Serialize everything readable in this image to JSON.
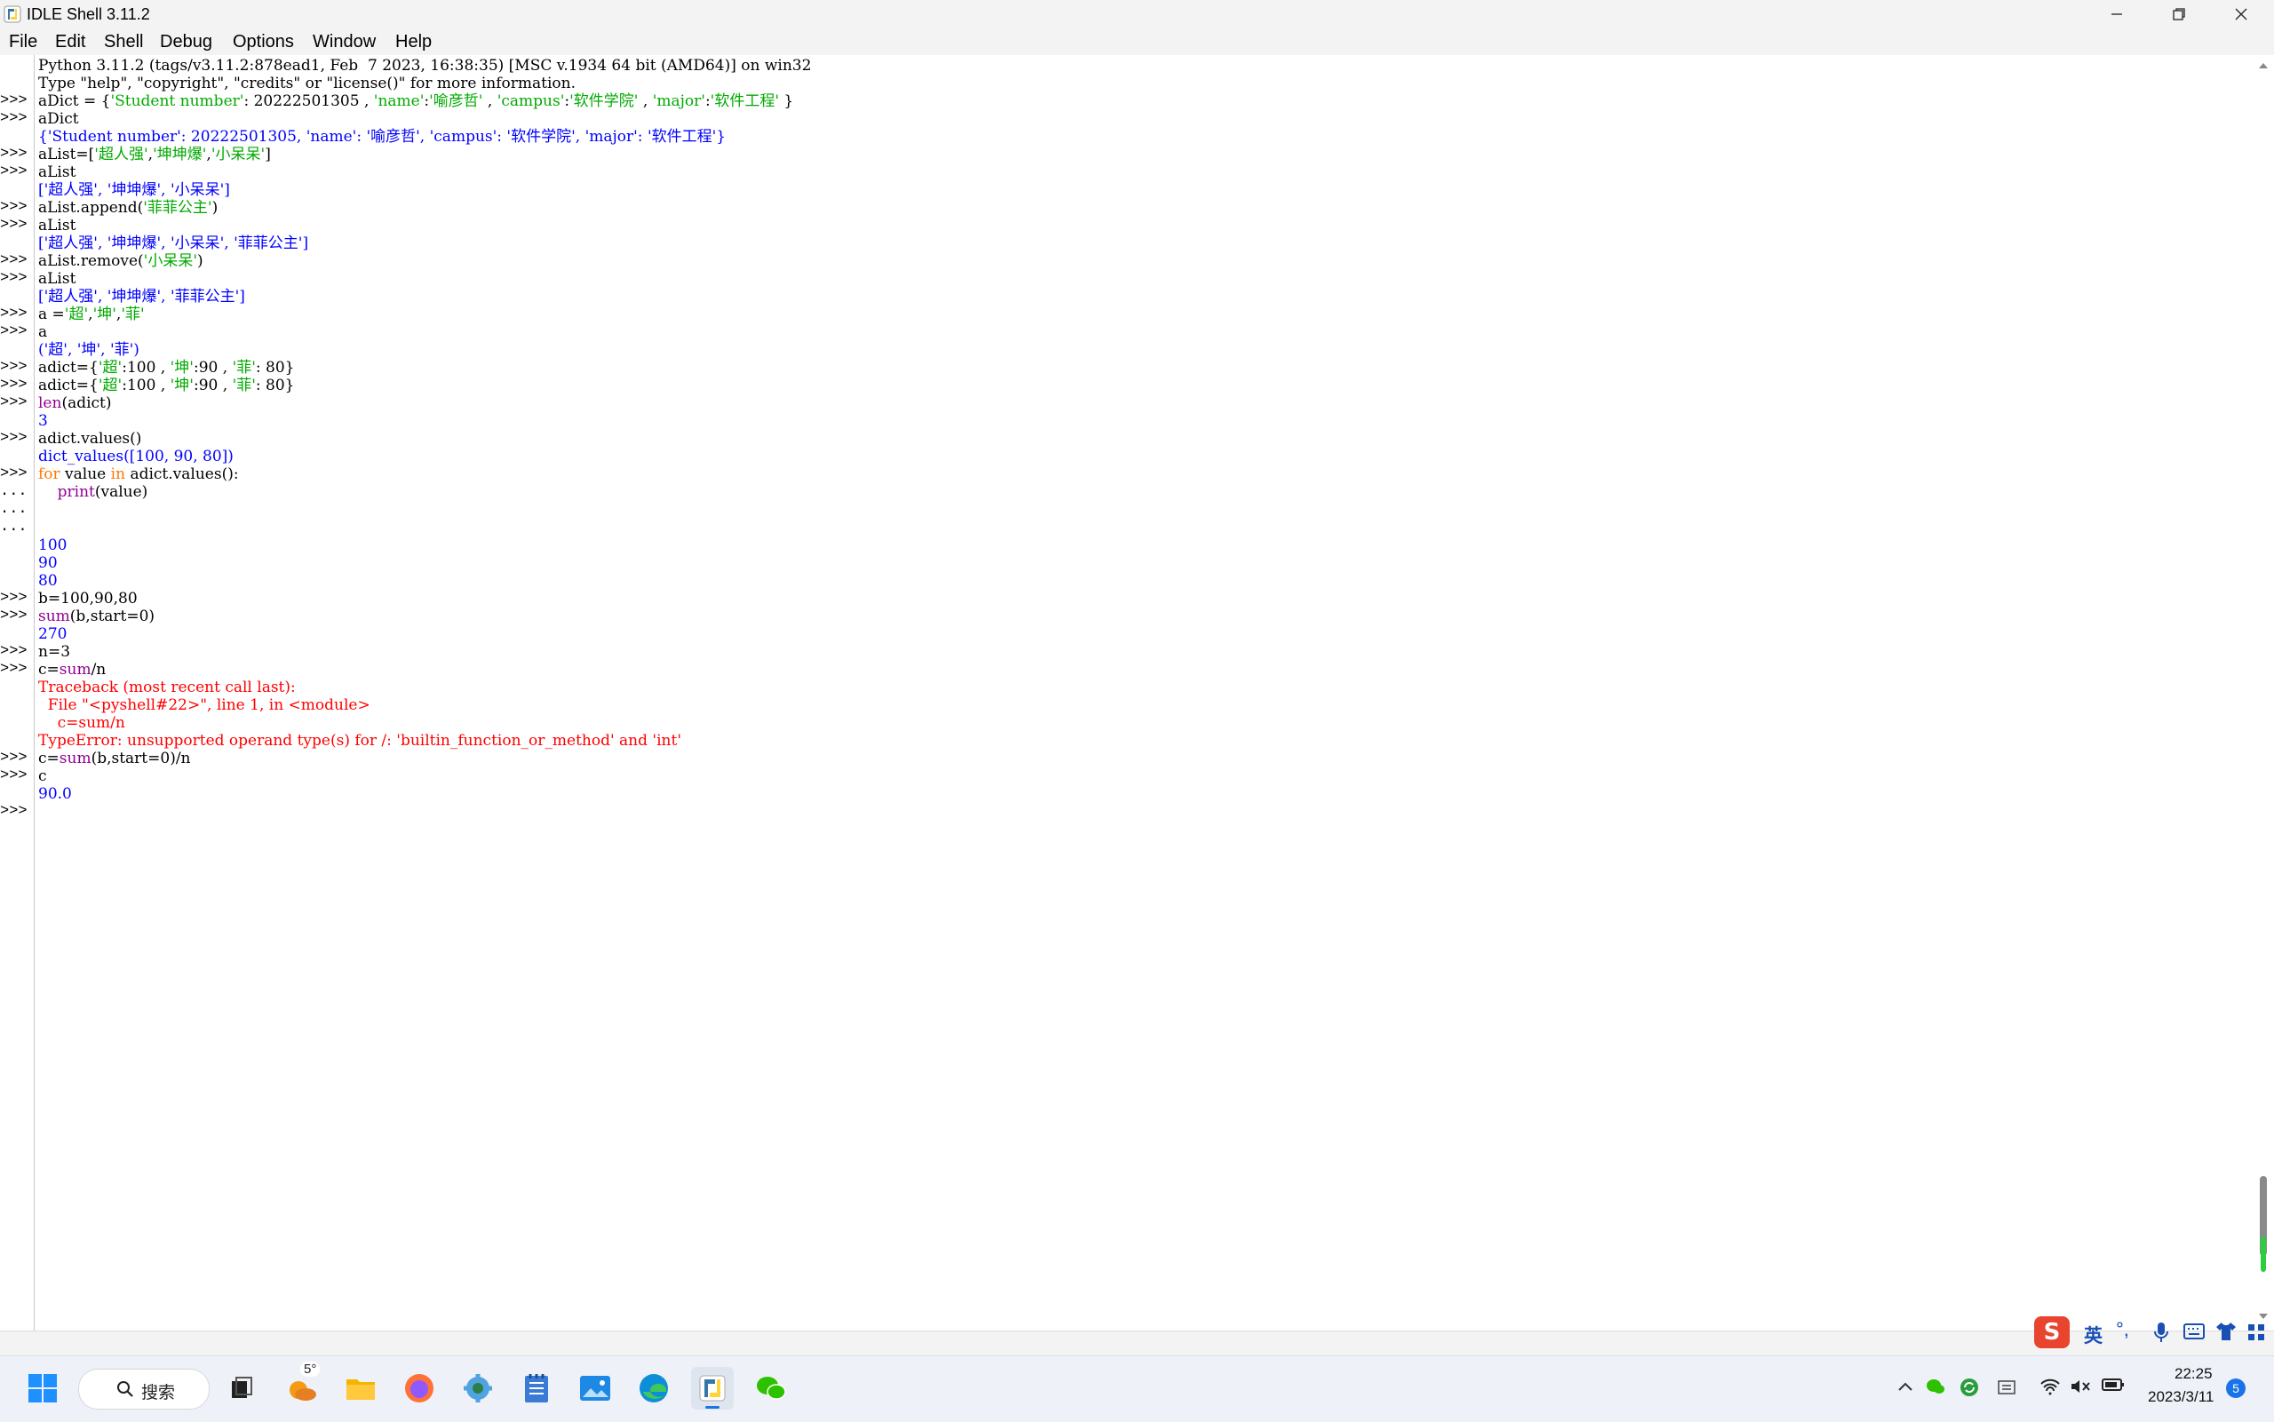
{
  "window": {
    "title": "IDLE Shell 3.11.2"
  },
  "menu": [
    "File",
    "Edit",
    "Shell",
    "Debug",
    "Options",
    "Window",
    "Help"
  ],
  "gutter": [
    "",
    "",
    ">>>",
    ">>>",
    "",
    ">>>",
    ">>>",
    "",
    ">>>",
    ">>>",
    "",
    ">>>",
    ">>>",
    "",
    ">>>",
    ">>>",
    "",
    ">>>",
    ">>>",
    ">>>",
    "",
    ">>>",
    "",
    ">>>",
    "...",
    "...",
    "...",
    "",
    "",
    "",
    ">>>",
    ">>>",
    "",
    ">>>",
    ">>>",
    "",
    "",
    "",
    "",
    ">>>",
    ">>>",
    "",
    ">>>"
  ],
  "lines": [
    [
      {
        "t": "Python 3.11.2 (tags/v3.11.2:878ead1, Feb  7 2023, 16:38:35) [MSC v.1934 64 bit (AMD64)] on win32",
        "c": ""
      }
    ],
    [
      {
        "t": "Type \"help\", \"copyright\", \"credits\" or \"license()\" for more information.",
        "c": ""
      }
    ],
    [
      {
        "t": "aDict = {",
        "c": ""
      },
      {
        "t": "'Student number'",
        "c": "s"
      },
      {
        "t": ": 20222501305 , ",
        "c": ""
      },
      {
        "t": "'name'",
        "c": "s"
      },
      {
        "t": ":",
        "c": ""
      },
      {
        "t": "'喻彦哲'",
        "c": "s"
      },
      {
        "t": " , ",
        "c": ""
      },
      {
        "t": "'campus'",
        "c": "s"
      },
      {
        "t": ":",
        "c": ""
      },
      {
        "t": "'软件学院'",
        "c": "s"
      },
      {
        "t": " , ",
        "c": ""
      },
      {
        "t": "'major'",
        "c": "s"
      },
      {
        "t": ":",
        "c": ""
      },
      {
        "t": "'软件工程'",
        "c": "s"
      },
      {
        "t": " }",
        "c": ""
      }
    ],
    [
      {
        "t": "aDict",
        "c": ""
      }
    ],
    [
      {
        "t": "{'Student number': 20222501305, 'name': '喻彦哲', 'campus': '软件学院', 'major': '软件工程'}",
        "c": "o"
      }
    ],
    [
      {
        "t": "aList=[",
        "c": ""
      },
      {
        "t": "'超人强'",
        "c": "s"
      },
      {
        "t": ",",
        "c": ""
      },
      {
        "t": "'坤坤爆'",
        "c": "s"
      },
      {
        "t": ",",
        "c": ""
      },
      {
        "t": "'小呆呆'",
        "c": "s"
      },
      {
        "t": "]",
        "c": ""
      }
    ],
    [
      {
        "t": "aList",
        "c": ""
      }
    ],
    [
      {
        "t": "['超人强', '坤坤爆', '小呆呆']",
        "c": "o"
      }
    ],
    [
      {
        "t": "aList.append(",
        "c": ""
      },
      {
        "t": "'菲菲公主'",
        "c": "s"
      },
      {
        "t": ")",
        "c": ""
      }
    ],
    [
      {
        "t": "aList",
        "c": ""
      }
    ],
    [
      {
        "t": "['超人强', '坤坤爆', '小呆呆', '菲菲公主']",
        "c": "o"
      }
    ],
    [
      {
        "t": "aList.remove(",
        "c": ""
      },
      {
        "t": "'小呆呆'",
        "c": "s"
      },
      {
        "t": ")",
        "c": ""
      }
    ],
    [
      {
        "t": "aList",
        "c": ""
      }
    ],
    [
      {
        "t": "['超人强', '坤坤爆', '菲菲公主']",
        "c": "o"
      }
    ],
    [
      {
        "t": "a =",
        "c": ""
      },
      {
        "t": "'超'",
        "c": "s"
      },
      {
        "t": ",",
        "c": ""
      },
      {
        "t": "'坤'",
        "c": "s"
      },
      {
        "t": ",",
        "c": ""
      },
      {
        "t": "'菲'",
        "c": "s"
      }
    ],
    [
      {
        "t": "a",
        "c": ""
      }
    ],
    [
      {
        "t": "('超', '坤', '菲')",
        "c": "o"
      }
    ],
    [
      {
        "t": "adict={",
        "c": ""
      },
      {
        "t": "'超'",
        "c": "s"
      },
      {
        "t": ":100 , ",
        "c": ""
      },
      {
        "t": "'坤'",
        "c": "s"
      },
      {
        "t": ":90 , ",
        "c": ""
      },
      {
        "t": "'菲'",
        "c": "s"
      },
      {
        "t": ": 80}",
        "c": ""
      }
    ],
    [
      {
        "t": "adict={",
        "c": ""
      },
      {
        "t": "'超'",
        "c": "s"
      },
      {
        "t": ":100 , ",
        "c": ""
      },
      {
        "t": "'坤'",
        "c": "s"
      },
      {
        "t": ":90 , ",
        "c": ""
      },
      {
        "t": "'菲'",
        "c": "s"
      },
      {
        "t": ": 80}",
        "c": ""
      }
    ],
    [
      {
        "t": "len",
        "c": "b"
      },
      {
        "t": "(adict)",
        "c": ""
      }
    ],
    [
      {
        "t": "3",
        "c": "o"
      }
    ],
    [
      {
        "t": "adict.values()",
        "c": ""
      }
    ],
    [
      {
        "t": "dict_values([100, 90, 80])",
        "c": "o"
      }
    ],
    [
      {
        "t": "for",
        "c": "k"
      },
      {
        "t": " value ",
        "c": ""
      },
      {
        "t": "in",
        "c": "k"
      },
      {
        "t": " adict.values():",
        "c": ""
      }
    ],
    [
      {
        "t": "    ",
        "c": ""
      },
      {
        "t": "print",
        "c": "b"
      },
      {
        "t": "(value)",
        "c": ""
      }
    ],
    [
      {
        "t": "",
        "c": ""
      }
    ],
    [
      {
        "t": "",
        "c": ""
      }
    ],
    [
      {
        "t": "100",
        "c": "o"
      }
    ],
    [
      {
        "t": "90",
        "c": "o"
      }
    ],
    [
      {
        "t": "80",
        "c": "o"
      }
    ],
    [
      {
        "t": "b=100,90,80",
        "c": ""
      }
    ],
    [
      {
        "t": "sum",
        "c": "b"
      },
      {
        "t": "(b,start=0)",
        "c": ""
      }
    ],
    [
      {
        "t": "270",
        "c": "o"
      }
    ],
    [
      {
        "t": "n=3",
        "c": ""
      }
    ],
    [
      {
        "t": "c=",
        "c": ""
      },
      {
        "t": "sum",
        "c": "b"
      },
      {
        "t": "/n",
        "c": ""
      }
    ],
    [
      {
        "t": "Traceback (most recent call last):",
        "c": "e"
      }
    ],
    [
      {
        "t": "  File \"<pyshell#22>\", line 1, in <module>",
        "c": "e"
      }
    ],
    [
      {
        "t": "    c=sum/n",
        "c": "e"
      }
    ],
    [
      {
        "t": "TypeError: unsupported operand type(s) for /: 'builtin_function_or_method' and 'int'",
        "c": "e"
      }
    ],
    [
      {
        "t": "c=",
        "c": ""
      },
      {
        "t": "sum",
        "c": "b"
      },
      {
        "t": "(b,start=0)/n",
        "c": ""
      }
    ],
    [
      {
        "t": "c",
        "c": ""
      }
    ],
    [
      {
        "t": "90.0",
        "c": "o"
      }
    ],
    [
      {
        "t": "",
        "c": ""
      }
    ]
  ],
  "taskbar": {
    "search_label": "搜索",
    "weather_badge": "5°"
  },
  "ime": {
    "lang": "英"
  },
  "tray": {
    "time": "22:25",
    "date": "2023/3/11",
    "notifications": "5"
  },
  "colors": {
    "keyword": "#ff7700",
    "string": "#00aa00",
    "output": "#0000ff",
    "error": "#ff0000",
    "builtin": "#900090"
  }
}
